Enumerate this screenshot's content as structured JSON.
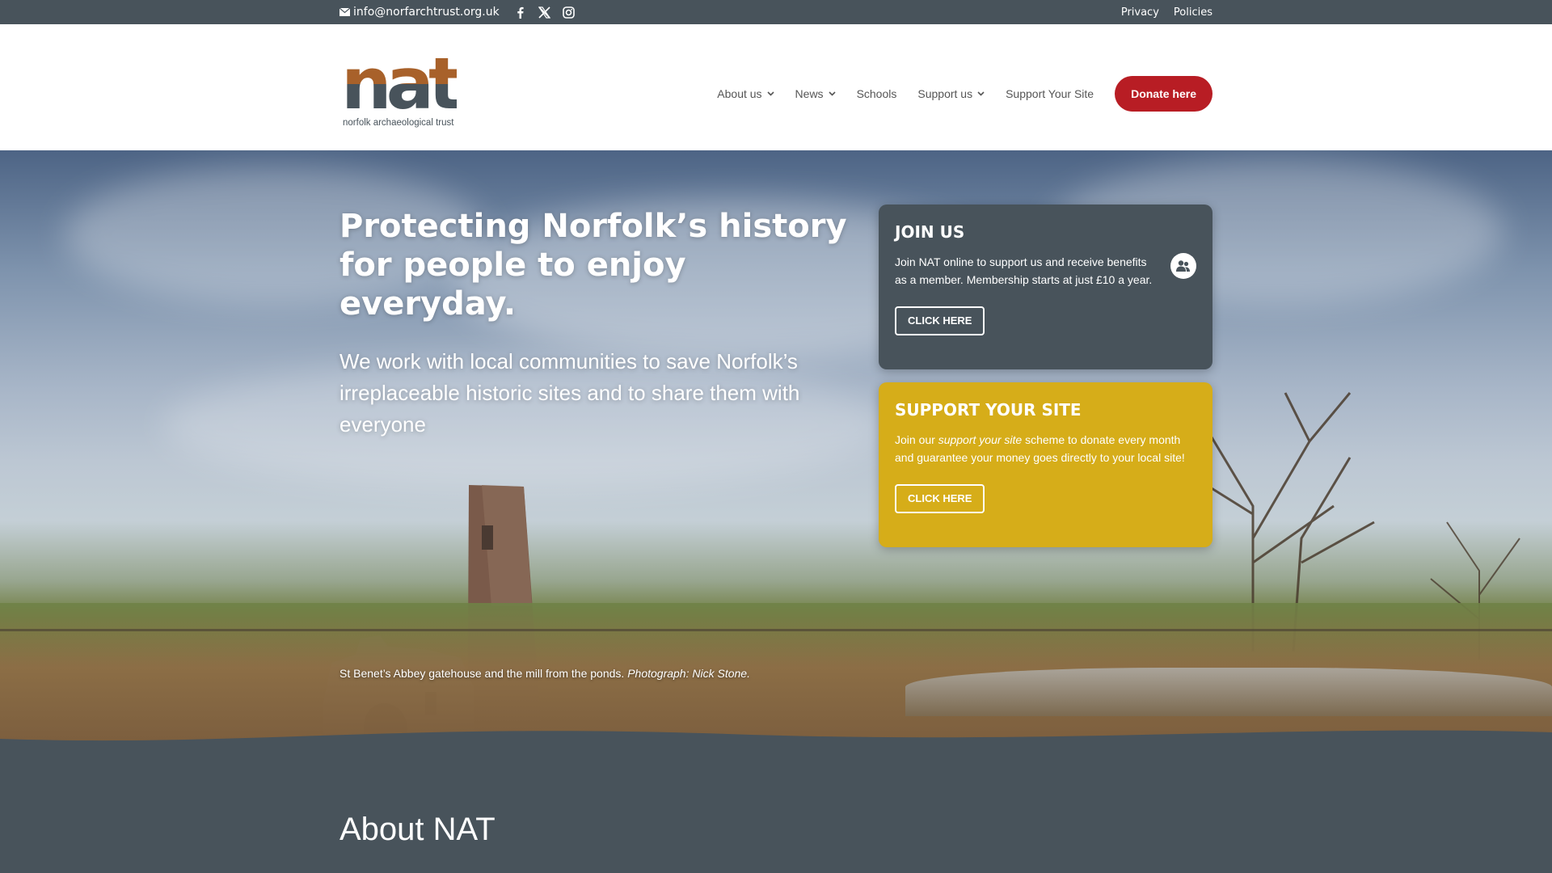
{
  "topbar": {
    "email": "info@norfarchtrust.org.uk",
    "social": [
      "facebook-icon",
      "x-icon",
      "instagram-icon"
    ],
    "links": [
      "Privacy",
      "Policies"
    ]
  },
  "logo": {
    "mark": "nat",
    "subtitle": "norfolk archaeological trust"
  },
  "nav": {
    "items": [
      {
        "label": "About us",
        "dropdown": true
      },
      {
        "label": "News",
        "dropdown": true
      },
      {
        "label": "Schools",
        "dropdown": false
      },
      {
        "label": "Support us",
        "dropdown": true
      },
      {
        "label": "Support Your Site",
        "dropdown": false
      }
    ],
    "donate": "Donate here"
  },
  "hero": {
    "title": "Protecting Norfolk’s history for people to enjoy everyday.",
    "lead": "We work with local communities to save Norfolk’s irreplaceable historic sites and to share them with everyone",
    "caption_text": "St Benet’s Abbey gatehouse and the mill from the ponds. ",
    "caption_credit": "Photograph: Nick Stone."
  },
  "cards": {
    "join": {
      "title": "JOIN US",
      "text": "Join NAT online to support us and receive benefits as a member. Membership starts at just £10 a year.",
      "button": "CLICK HERE",
      "icon": "members-icon"
    },
    "support": {
      "title": "SUPPORT YOUR SITE",
      "text_before": "Join our ",
      "text_em": "support your site",
      "text_after": " scheme to donate every month and guarantee your money goes directly to your local site!",
      "button": "CLICK HERE"
    }
  },
  "about": {
    "title": "About NAT"
  },
  "colors": {
    "slate": "#48535b",
    "donate_red": "#b81d24",
    "gold": "#d6ad19",
    "logo_brown": "#a8612a"
  }
}
